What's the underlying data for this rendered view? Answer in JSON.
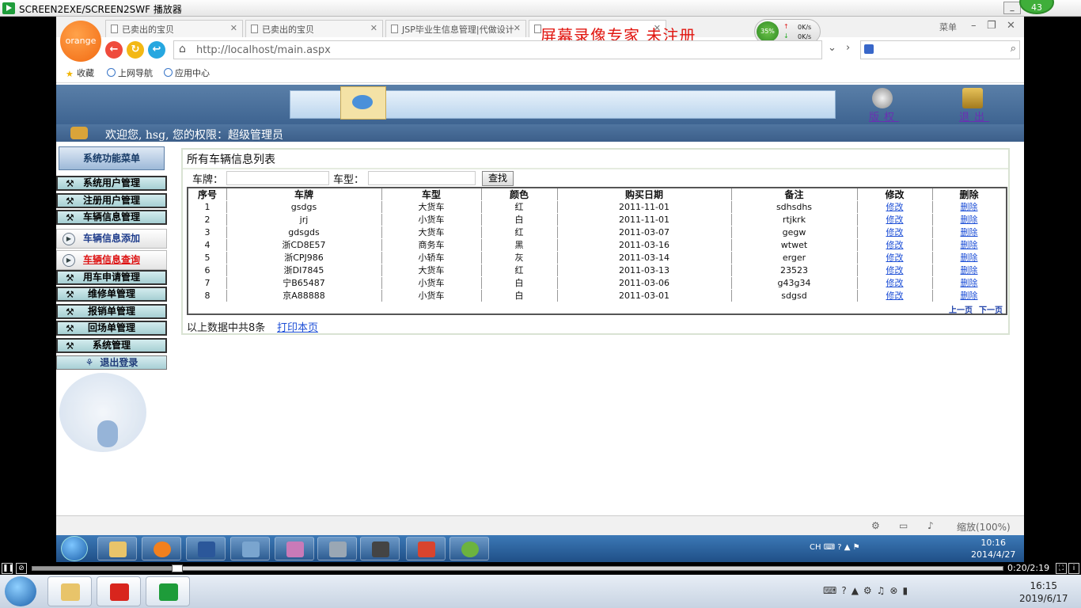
{
  "player": {
    "title": "SCREEN2EXE/SCREEN2SWF 播放器",
    "badge": "43",
    "time": "0:20/2:19"
  },
  "browser": {
    "logo": "orange",
    "tabs": [
      {
        "label": "已卖出的宝贝"
      },
      {
        "label": "已卖出的宝贝"
      },
      {
        "label": "JSP毕业生信息管理|代做设计"
      }
    ],
    "watermark": "屏幕录像专家  未注册",
    "speed": {
      "percent": "35%",
      "up": "0K/s",
      "down": "0K/s"
    },
    "menu_label": "菜单",
    "url": "http://localhost/main.aspx",
    "favorites": [
      {
        "label": "收藏"
      },
      {
        "label": "上网导航"
      },
      {
        "label": "应用中心"
      }
    ],
    "zoom": "缩放(100%)"
  },
  "header": {
    "auth_label": "版权",
    "exit_label": "退出",
    "welcome": "欢迎您, hsg, 您的权限：超级管理员"
  },
  "sidebar": {
    "title": "系统功能菜单",
    "items": [
      {
        "label": "系统用户管理"
      },
      {
        "label": "注册用户管理"
      },
      {
        "label": "车辆信息管理"
      }
    ],
    "sub_add": "车辆信息添加",
    "sub_query": "车辆信息查询",
    "items2": [
      {
        "label": "用车申请管理"
      },
      {
        "label": "维修单管理"
      },
      {
        "label": "报销单管理"
      },
      {
        "label": "回场单管理"
      },
      {
        "label": "系统管理"
      }
    ],
    "logout": "退出登录"
  },
  "content": {
    "title": "所有车辆信息列表",
    "plate_label": "车牌：",
    "type_label": "车型：",
    "search_button": "查找",
    "columns": [
      "序号",
      "车牌",
      "车型",
      "颜色",
      "购买日期",
      "备注",
      "修改",
      "删除"
    ],
    "rows": [
      {
        "no": "1",
        "plate": "gsdgs",
        "type": "大货车",
        "color": "红",
        "date": "2011-11-01",
        "note": "sdhsdhs",
        "edit": "修改",
        "del": "删除"
      },
      {
        "no": "2",
        "plate": "jrj",
        "type": "小货车",
        "color": "白",
        "date": "2011-11-01",
        "note": "rtjkrk",
        "edit": "修改",
        "del": "删除"
      },
      {
        "no": "3",
        "plate": "gdsgds",
        "type": "大货车",
        "color": "红",
        "date": "2011-03-07",
        "note": "gegw",
        "edit": "修改",
        "del": "删除"
      },
      {
        "no": "4",
        "plate": "浙CD8E57",
        "type": "商务车",
        "color": "黑",
        "date": "2011-03-16",
        "note": "wtwet",
        "edit": "修改",
        "del": "删除"
      },
      {
        "no": "5",
        "plate": "浙CPJ986",
        "type": "小轿车",
        "color": "灰",
        "date": "2011-03-14",
        "note": "erger",
        "edit": "修改",
        "del": "删除"
      },
      {
        "no": "6",
        "plate": "浙DI7845",
        "type": "大货车",
        "color": "红",
        "date": "2011-03-13",
        "note": "23523",
        "edit": "修改",
        "del": "删除"
      },
      {
        "no": "7",
        "plate": "宁B65487",
        "type": "小货车",
        "color": "白",
        "date": "2011-03-06",
        "note": "g43g34",
        "edit": "修改",
        "del": "删除"
      },
      {
        "no": "8",
        "plate": "京A88888",
        "type": "小货车",
        "color": "白",
        "date": "2011-03-01",
        "note": "sdgsd",
        "edit": "修改",
        "del": "删除"
      }
    ],
    "prev_page": "上一页",
    "next_page": "下一页",
    "summary": "以上数据中共8条",
    "print_link": "打印本页"
  },
  "inner_taskbar": {
    "time": "10:16",
    "date": "2014/4/27",
    "ime": "CH"
  },
  "outer_taskbar": {
    "time": "16:15",
    "date": "2019/6/17"
  },
  "colors": {
    "banner": "#4a6f9a",
    "link": "#1c4ed6",
    "watermark": "#e1150f"
  }
}
